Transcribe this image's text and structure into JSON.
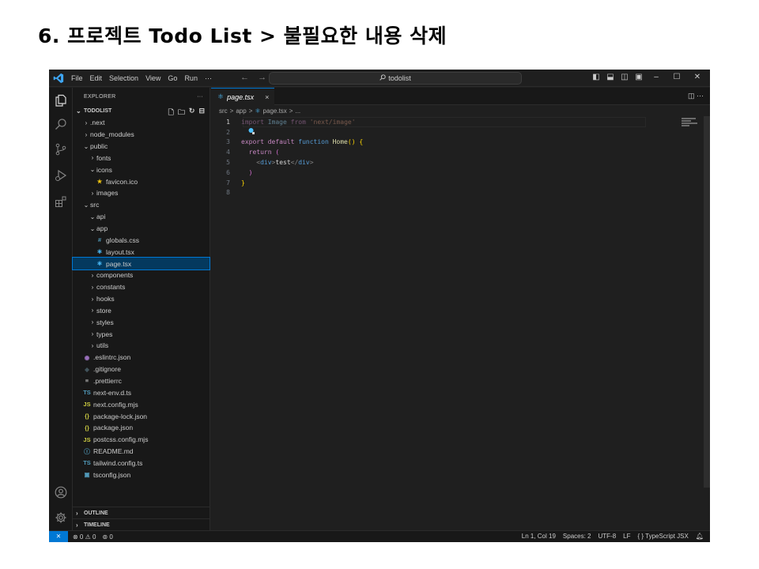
{
  "slide": {
    "title": "6. 프로젝트 Todo List > 불필요한 내용 삭제"
  },
  "titlebar": {
    "menu": [
      "File",
      "Edit",
      "Selection",
      "View",
      "Go",
      "Run",
      "⋯"
    ],
    "nav_back": "←",
    "nav_forward": "→",
    "search": "todolist",
    "icons": [
      "toggle-primary-sidebar-icon",
      "toggle-panel-icon",
      "toggle-secondary-sidebar-icon",
      "customize-layout-icon",
      "minimize-icon",
      "maximize-icon",
      "close-icon"
    ]
  },
  "activitybar": {
    "icons": [
      "explorer-icon",
      "search-icon",
      "source-control-icon",
      "run-debug-icon",
      "extensions-icon",
      "account-icon",
      "settings-gear-icon"
    ]
  },
  "sidebar": {
    "header": "EXPLORER",
    "more": "···",
    "project": "TODOLIST",
    "tree": [
      {
        "label": ".next",
        "type": "folder",
        "depth": 1,
        "open": false
      },
      {
        "label": "node_modules",
        "type": "folder",
        "depth": 1,
        "open": false
      },
      {
        "label": "public",
        "type": "folder",
        "depth": 1,
        "open": true
      },
      {
        "label": "fonts",
        "type": "folder",
        "depth": 2,
        "open": false
      },
      {
        "label": "icons",
        "type": "folder",
        "depth": 2,
        "open": true
      },
      {
        "label": "favicon.ico",
        "type": "file",
        "depth": 3,
        "icon": "★",
        "color": "#f1c40f"
      },
      {
        "label": "images",
        "type": "folder",
        "depth": 2,
        "open": false
      },
      {
        "label": "src",
        "type": "folder",
        "depth": 1,
        "open": true
      },
      {
        "label": "api",
        "type": "folder",
        "depth": 2,
        "open": true
      },
      {
        "label": "app",
        "type": "folder",
        "depth": 2,
        "open": true
      },
      {
        "label": "globals.css",
        "type": "file",
        "depth": 3,
        "icon": "#",
        "color": "#519aba"
      },
      {
        "label": "layout.tsx",
        "type": "file",
        "depth": 3,
        "icon": "⚛",
        "color": "#4fc1ff"
      },
      {
        "label": "page.tsx",
        "type": "file",
        "depth": 3,
        "icon": "⚛",
        "color": "#4fc1ff",
        "selected": true
      },
      {
        "label": "components",
        "type": "folder",
        "depth": 2,
        "open": false
      },
      {
        "label": "constants",
        "type": "folder",
        "depth": 2,
        "open": false
      },
      {
        "label": "hooks",
        "type": "folder",
        "depth": 2,
        "open": false
      },
      {
        "label": "store",
        "type": "folder",
        "depth": 2,
        "open": false
      },
      {
        "label": "styles",
        "type": "folder",
        "depth": 2,
        "open": false
      },
      {
        "label": "types",
        "type": "folder",
        "depth": 2,
        "open": false
      },
      {
        "label": "utils",
        "type": "folder",
        "depth": 2,
        "open": false
      },
      {
        "label": ".eslintrc.json",
        "type": "file",
        "depth": 1,
        "icon": "◉",
        "color": "#a074c4"
      },
      {
        "label": ".gitignore",
        "type": "file",
        "depth": 1,
        "icon": "◆",
        "color": "#41535b"
      },
      {
        "label": ".prettierrc",
        "type": "file",
        "depth": 1,
        "icon": "≡",
        "color": "#cccccc"
      },
      {
        "label": "next-env.d.ts",
        "type": "file",
        "depth": 1,
        "icon": "TS",
        "color": "#519aba"
      },
      {
        "label": "next.config.mjs",
        "type": "file",
        "depth": 1,
        "icon": "JS",
        "color": "#cbcb41"
      },
      {
        "label": "package-lock.json",
        "type": "file",
        "depth": 1,
        "icon": "{}",
        "color": "#cbcb41"
      },
      {
        "label": "package.json",
        "type": "file",
        "depth": 1,
        "icon": "{}",
        "color": "#cbcb41"
      },
      {
        "label": "postcss.config.mjs",
        "type": "file",
        "depth": 1,
        "icon": "JS",
        "color": "#cbcb41"
      },
      {
        "label": "README.md",
        "type": "file",
        "depth": 1,
        "icon": "ⓘ",
        "color": "#519aba"
      },
      {
        "label": "tailwind.config.ts",
        "type": "file",
        "depth": 1,
        "icon": "TS",
        "color": "#519aba"
      },
      {
        "label": "tsconfig.json",
        "type": "file",
        "depth": 1,
        "icon": "▣",
        "color": "#519aba"
      }
    ],
    "outline": "OUTLINE",
    "timeline": "TIMELINE"
  },
  "editor": {
    "tab_label": "page.tsx",
    "tab_close": "×",
    "breadcrumb": [
      "src",
      ">",
      "app",
      ">",
      "page.tsx",
      ">",
      "..."
    ],
    "lines": [
      {
        "n": "1",
        "active": true,
        "tokens": [
          [
            "import ",
            "kw dim"
          ],
          [
            "Image ",
            "id dim"
          ],
          [
            "from ",
            "kw dim"
          ],
          [
            "'next/image'",
            "str dim"
          ]
        ]
      },
      {
        "n": "2",
        "tokens": []
      },
      {
        "n": "3",
        "tokens": [
          [
            "export ",
            "kw"
          ],
          [
            "default ",
            "kw"
          ],
          [
            "function ",
            "kw2"
          ],
          [
            "Home",
            "fn"
          ],
          [
            "() ",
            "br"
          ],
          [
            "{",
            "br"
          ]
        ]
      },
      {
        "n": "4",
        "tokens": [
          [
            "  return ",
            "kw"
          ],
          [
            "(",
            "br2"
          ]
        ]
      },
      {
        "n": "5",
        "tokens": [
          [
            "    <",
            "punct"
          ],
          [
            "div",
            "tag"
          ],
          [
            ">",
            "punct"
          ],
          [
            "test",
            "plain"
          ],
          [
            "</",
            "punct"
          ],
          [
            "div",
            "tag"
          ],
          [
            ">",
            "punct"
          ]
        ]
      },
      {
        "n": "6",
        "tokens": [
          [
            "  )",
            "br2"
          ]
        ]
      },
      {
        "n": "7",
        "tokens": [
          [
            "}",
            "br"
          ]
        ]
      },
      {
        "n": "8",
        "tokens": []
      }
    ]
  },
  "status": {
    "remote": "⨯",
    "problems": "⊗ 0 ⚠ 0",
    "ports": "⊚ 0",
    "cursor": "Ln 1, Col 19",
    "spaces": "Spaces: 2",
    "encoding": "UTF-8",
    "eol": "LF",
    "language": "{ } TypeScript JSX",
    "bell": "⌂"
  }
}
